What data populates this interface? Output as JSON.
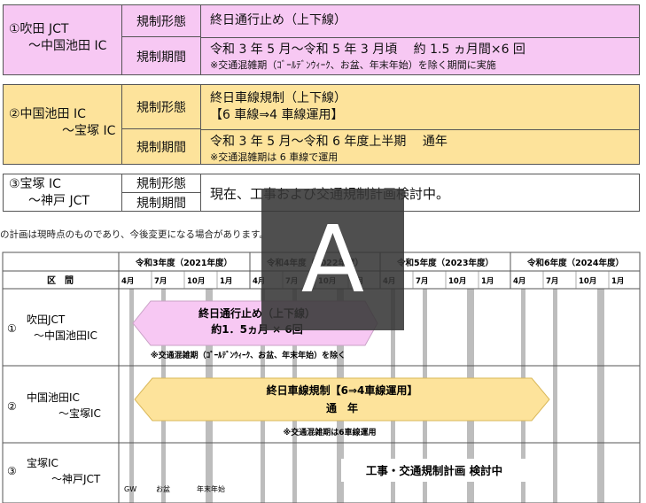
{
  "sections": [
    {
      "name_line1": "①吹田 JCT",
      "name_line2": "～中国池田 IC",
      "type_label": "規制形態",
      "type_value": "終日通行止め（上下線）",
      "period_label": "規制期間",
      "period_value": "令和 3 年 5 月～令和 5 年 3 月頃　 約 1.5 ヵ月間×6 回",
      "period_note": "※交通混雑期（ｺﾞｰﾙﾃﾞﾝｳｨｰｸ、お盆、年末年始）を除く期間に実施"
    },
    {
      "name_line1": "②中国池田 IC",
      "name_line2": "～宝塚 IC",
      "type_label": "規制形態",
      "type_value": "終日車線規制（上下線）",
      "type_value2": "【6 車線⇒4 車線運用】",
      "period_label": "規制期間",
      "period_value": "令和 3 年 5 月～令和 6 年度上半期　 通年",
      "period_note": "※交通混雑期は 6 車線で運用"
    },
    {
      "name_line1": "③宝塚 IC",
      "name_line2": "～神戸 JCT",
      "type_label": "規制形態",
      "period_label": "規制期間",
      "value": "現在、工事および交通規制計画検討中。"
    }
  ],
  "note": "の計画は現時点のものであり、今後変更になる場合があります。",
  "schedule": {
    "header_section": "区　間",
    "years": [
      "令和3年度（2021年度）",
      "令和4年度（2022年度）",
      "令和5年度（2023年度）",
      "令和6年度（2024年度）"
    ],
    "months": [
      "4月",
      "7月",
      "10月",
      "1月"
    ],
    "rows": [
      {
        "num": "①",
        "name1": "吹田JCT",
        "name2": "～中国池田IC"
      },
      {
        "num": "②",
        "name1": "中国池田IC",
        "name2": "～宝塚IC"
      },
      {
        "num": "③",
        "name1": "宝塚IC",
        "name2": "～神戸JCT"
      }
    ],
    "bar1_line1": "終日通行止め（上下線）",
    "bar1_line2": "約1．5ヵ月 × 6回",
    "bar1_note": "※交通混雑期（ｺﾞｰﾙﾃﾞﾝｳｨｰｸ、お盆、年末年始）を除く",
    "bar2_line1": "終日車線規制【6⇒4車線運用】",
    "bar2_line2": "通　年",
    "bar2_note": "※交通混雑期は6車線運用",
    "row3_text": "工事・交通規制計画 検討中",
    "legend_gw": "GW",
    "legend_obon": "お盆",
    "legend_nenmatsu": "年末年始",
    "colors": {
      "pink": "#f7c8f3",
      "yellow": "#fde39b",
      "stripe": "#bdbdbd"
    }
  },
  "overlay_letter": "A"
}
